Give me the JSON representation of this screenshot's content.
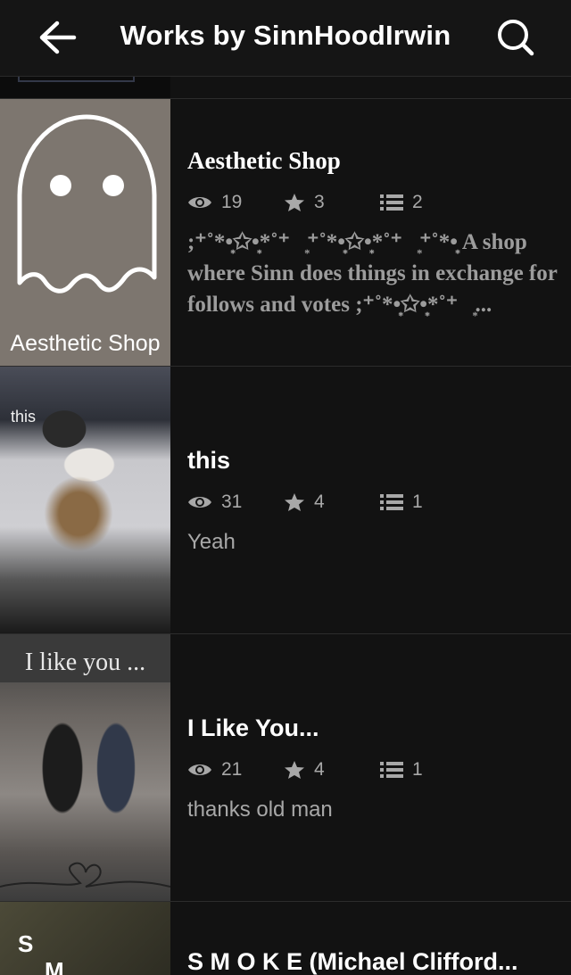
{
  "header": {
    "title": "Works by SinnHoodIrwin"
  },
  "works": [
    {
      "title": "Aesthetic Shop",
      "cover_caption": "Aesthetic Shop",
      "reads": "19",
      "votes": "3",
      "parts": "2",
      "description": ";⁺˚*•̩̩͙✩•̩̩͙*˚⁺‧͙⁺˚*•̩̩͙✩•̩̩͙*˚⁺‧͙⁺˚*•̩̩͙ A shop where Sinn does  things in exchange for  follows and votes ;⁺˚*•̩̩͙✩•̩̩͙*˚⁺‧͙..."
    },
    {
      "title": "this",
      "cover_tag": "this",
      "reads": "31",
      "votes": "4",
      "parts": "1",
      "description": "Yeah"
    },
    {
      "title": "I Like You...",
      "cover_text": "I like you ...",
      "reads": "21",
      "votes": "4",
      "parts": "1",
      "description": "thanks old man"
    },
    {
      "title": "S M O K E  (Michael Clifford...",
      "cover_letters": [
        "S",
        "M"
      ]
    }
  ]
}
